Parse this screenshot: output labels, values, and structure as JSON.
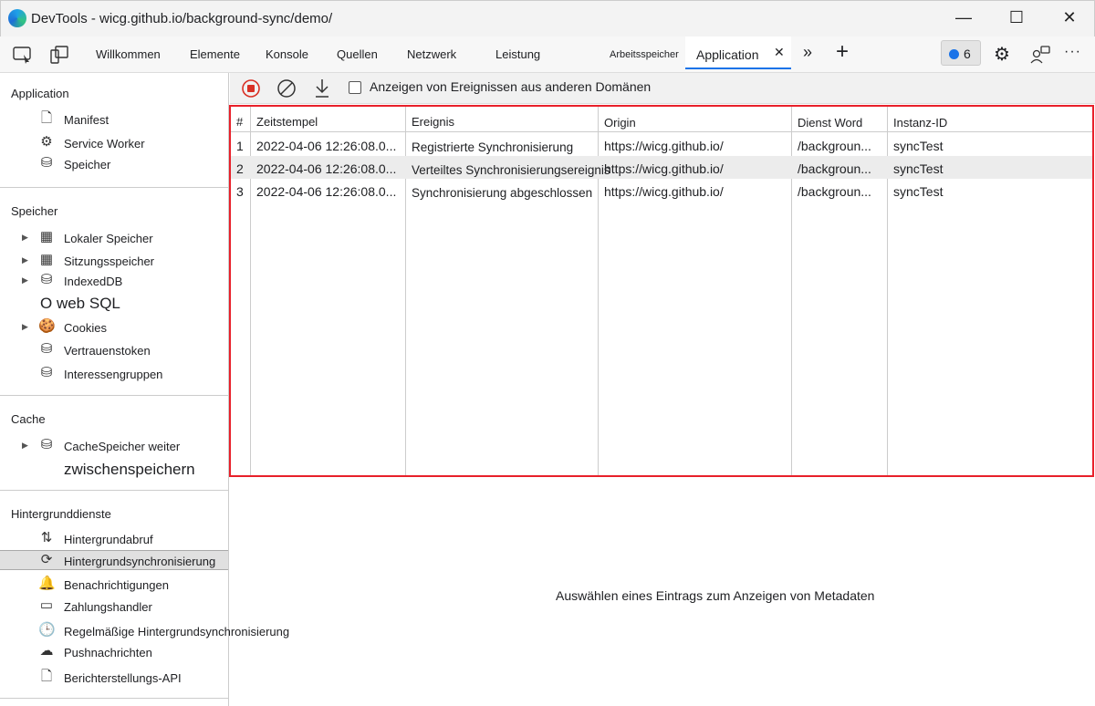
{
  "window": {
    "title": "DevTools - wicg.github.io/background-sync/demo/",
    "minimize": "—",
    "maximize": "☐",
    "close": "✕"
  },
  "tabs": [
    {
      "label": "Willkommen"
    },
    {
      "label": "Elemente"
    },
    {
      "label": "Konsole"
    },
    {
      "label": "Quellen"
    },
    {
      "label": "Netzwerk"
    },
    {
      "label": "Leistung"
    },
    {
      "label": "Arbeitsspeicher"
    },
    {
      "label": "Application"
    }
  ],
  "tabbar": {
    "more": "»",
    "add": "+",
    "issues_count": "6",
    "menu": "···"
  },
  "sidebar": {
    "sections": [
      {
        "title": "Application",
        "items": [
          {
            "label": "Manifest",
            "icon": "file-icon"
          },
          {
            "label": "Service Worker",
            "icon": "gear-icon"
          },
          {
            "label": "Speicher",
            "icon": "database-icon"
          }
        ]
      },
      {
        "title": "Speicher",
        "items": [
          {
            "label": "Lokaler Speicher",
            "icon": "grid-icon"
          },
          {
            "label": "Sitzungsspeicher",
            "icon": "grid-icon"
          },
          {
            "label": "IndexedDB",
            "icon": "database-icon"
          },
          {
            "label": "O web SQL",
            "icon": ""
          },
          {
            "label": "Cookies",
            "icon": "cookie-icon"
          },
          {
            "label": "Vertrauenstoken",
            "icon": "database-icon"
          },
          {
            "label": "Interessengruppen",
            "icon": "database-icon"
          }
        ]
      },
      {
        "title": "Cache",
        "items": [
          {
            "label": "CacheSpeicher weiter",
            "icon": "database-icon"
          },
          {
            "label": "zwischenspeichern",
            "icon": ""
          }
        ]
      },
      {
        "title": "Hintergrunddienste",
        "items": [
          {
            "label": "Hintergrundabruf",
            "icon": "arrows-icon"
          },
          {
            "label": "Hintergrundsynchronisierung",
            "icon": "sync-icon",
            "selected": true
          },
          {
            "label": "Benachrichtigungen",
            "icon": "bell-icon"
          },
          {
            "label": "Zahlungshandler",
            "icon": "card-icon"
          },
          {
            "label": "Regelmäßige Hintergrundsynchronisierung",
            "icon": "clock-icon"
          },
          {
            "label": "Pushnachrichten",
            "icon": "cloud-icon"
          },
          {
            "label": "Berichterstellungs-API",
            "icon": "file-icon"
          }
        ]
      }
    ]
  },
  "toolbar": {
    "checkbox_label": "Anzeigen von Ereignissen aus anderen Domänen",
    "checked": false,
    "record_color": "#d93025"
  },
  "table": {
    "columns": [
      "#",
      "Zeitstempel",
      "Ereignis",
      "Origin",
      "Dienst Word",
      "Instanz-ID"
    ],
    "rows": [
      [
        "1",
        "2022-04-06 12:26:08.0...",
        "Registrierte Synchronisierung",
        "https://wicg.github.io/",
        "/backgroun...",
        "syncTest"
      ],
      [
        "2",
        "2022-04-06 12:26:08.0...",
        "Verteiltes Synchronisierungsereignis",
        "https://wicg.github.io/",
        "/backgroun...",
        "syncTest"
      ],
      [
        "3",
        "2022-04-06 12:26:08.0...",
        "Synchronisierung abgeschlossen",
        "https://wicg.github.io/",
        "/backgroun...",
        "syncTest"
      ]
    ]
  },
  "detail": {
    "message": "Auswählen eines Eintrags zum Anzeigen von Metadaten"
  },
  "colors": {
    "highlight_border": "#e8202a",
    "accent": "#1a73e8"
  }
}
